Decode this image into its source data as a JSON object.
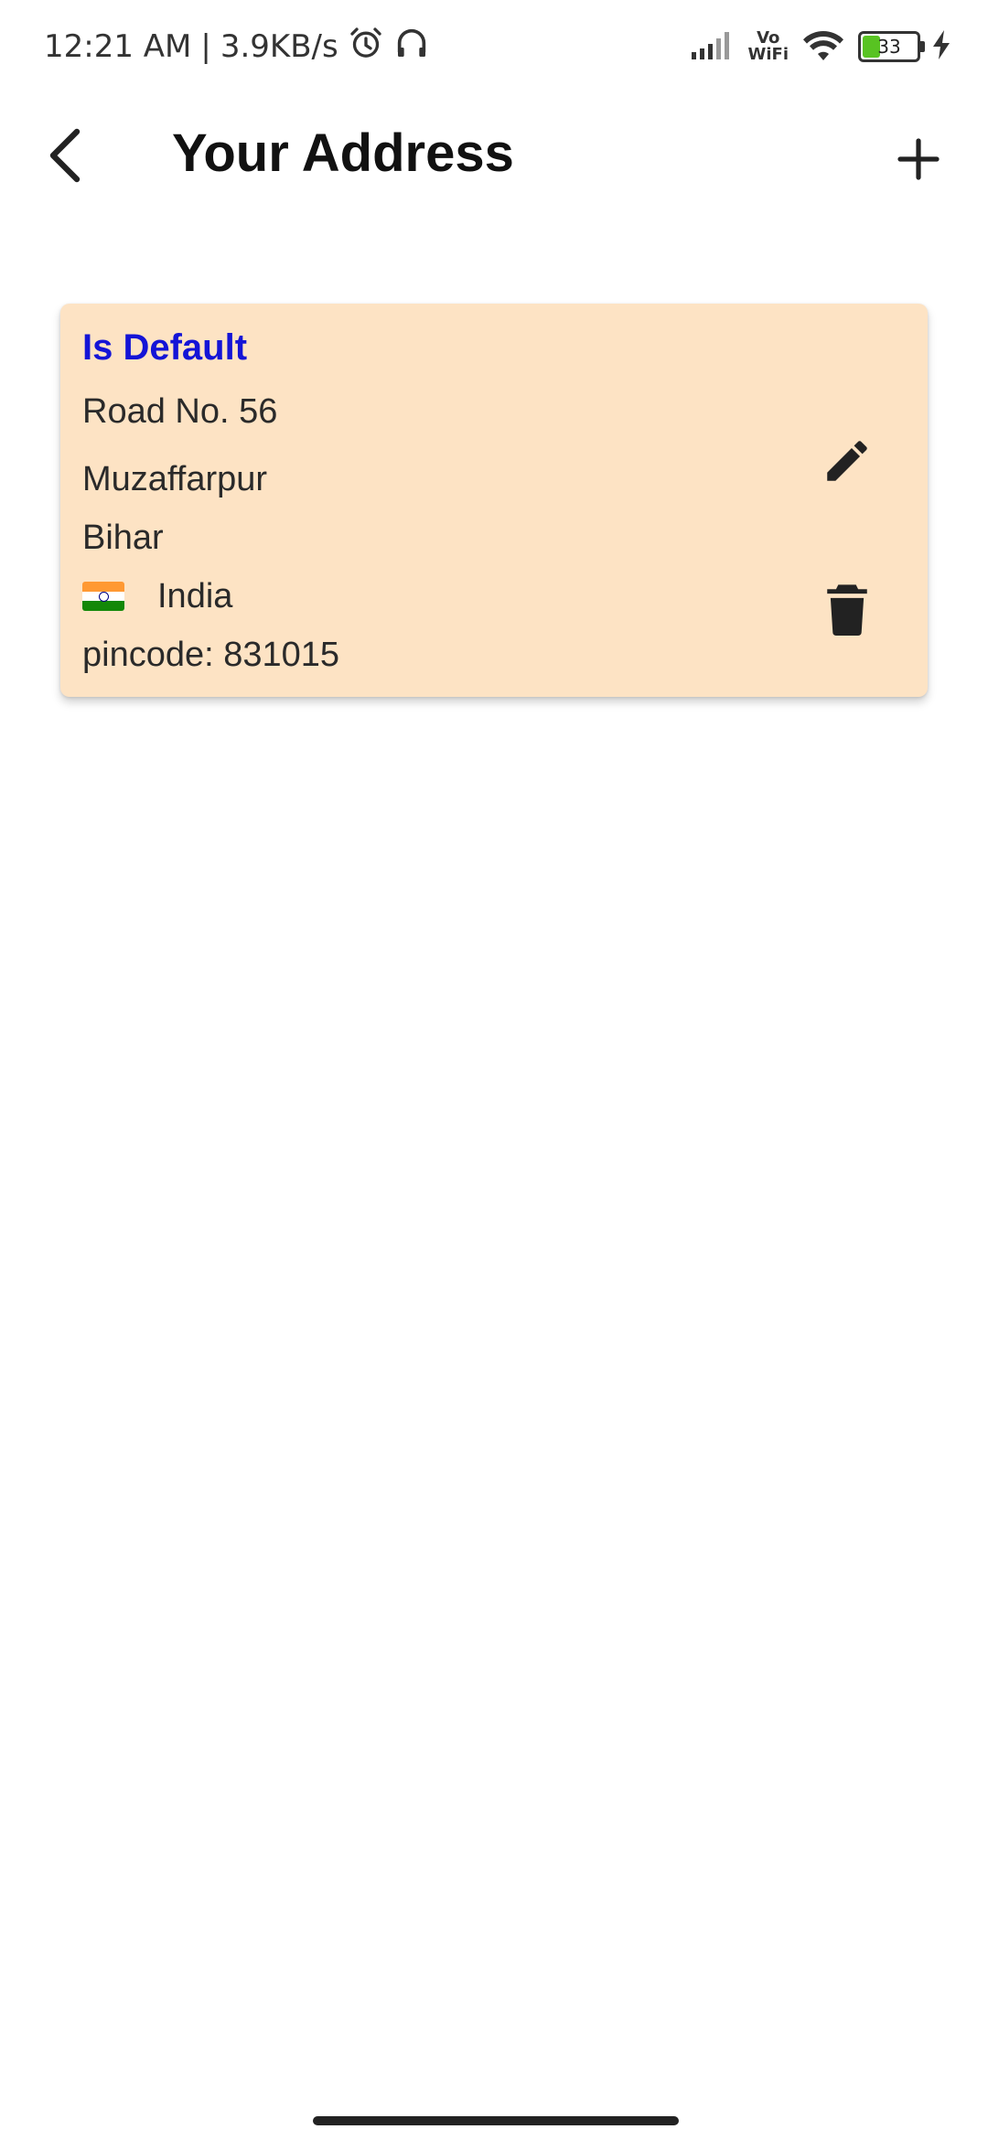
{
  "status_bar": {
    "time": "12:21 AM",
    "separator": "|",
    "speed": "3.9KB/s",
    "vowifi_top": "Vo",
    "vowifi_bottom": "WiFi",
    "battery_level": "33",
    "battery_fraction": 0.33,
    "battery_color": "#58c322",
    "icons": [
      "alarm-icon",
      "headphones-icon",
      "signal-icon",
      "wifi-icon",
      "battery-icon",
      "charging-icon"
    ]
  },
  "app_bar": {
    "title": "Your Address",
    "back_icon": "chevron-left-icon",
    "add_icon": "plus-icon"
  },
  "addresses": [
    {
      "default_label": "Is Default",
      "line1": "Road No. 56",
      "city": "Muzaffarpur",
      "state": "Bihar",
      "country": "India",
      "country_flag": "india-flag-icon",
      "pincode": "pincode: 831015",
      "card_color": "#fde3c4",
      "default_label_color": "#1414d6",
      "actions": [
        "edit-icon",
        "delete-icon"
      ]
    }
  ]
}
